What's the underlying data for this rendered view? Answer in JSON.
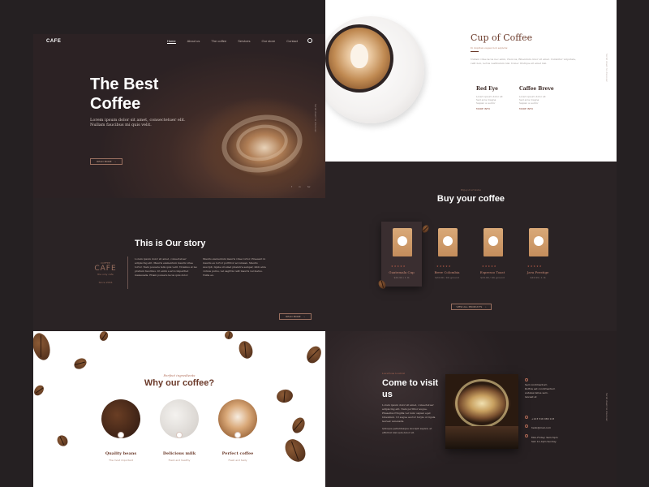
{
  "hero": {
    "logo": "CAFE",
    "nav": [
      "Home",
      "About us",
      "The coffee",
      "Services",
      "Our store",
      "Contact"
    ],
    "title": "The Best Coffee",
    "text": "Lorem ipsum dolor sit amet, consectetuer elit. Nullam faucibus mi quis velit.",
    "button": "READ MORE",
    "social": [
      "f",
      "in",
      "tw"
    ],
    "side_text": "Scroll down to discover"
  },
  "cup": {
    "title": "Cup of Coffee",
    "subtitle": "In dapibus augue non sapiens",
    "description": "Nullam vitae lacus nec enim, rhoncus, Bibendum dolor sit amet. Curabitur vulputate, velit non, lectus vestibulum nisi. Donec tristique sit amet nisi.",
    "items": [
      {
        "name": "Red Eye",
        "bullets": [
          "Lorem ipsum dolor sit",
          "Sed eros magna",
          "Sapien a auctor"
        ],
        "more": "MORE INFO"
      },
      {
        "name": "Caffee Breve",
        "bullets": [
          "Lorem ipsum dolor sit",
          "Sed eros magna",
          "Sapien a auctor"
        ],
        "more": "MORE INFO"
      }
    ],
    "side_text": "Scroll down to discover"
  },
  "story": {
    "title": "This is Our story",
    "badge_top": "COFFEE",
    "badge_main": "CAFE",
    "badge_sub": "the only cafe",
    "badge_since": "Since 2016",
    "col1": "Lorem ipsum dolor sit amet, consectetuer adipiscing elit. Mauris elementum mauris vitae tortor. Nam posuere felis quis velit. Vivamus et leo pretium faucibus. Ut enim a arcu imperdiet malesuada. Etiam posuere lacus quis dolor.",
    "col2": "Mauris elementum mauris vitae tortor. Praesent in mauris eu tortor porttitor accumsan. Mauris suscipit, ligula sit amet pharetra semper, nibh ante cursus purus, vel sagittis velit mauris vel metus. Nulla eu.",
    "button": "READ MORE"
  },
  "buy": {
    "sup": "Enjoy it at home",
    "title": "Buy your coffee",
    "stars": "★★★★★",
    "products": [
      {
        "name": "Guatemala Cup",
        "price": "$24.99 / 1 lb"
      },
      {
        "name": "Brew Colombia",
        "price": "$24.99 / 1lb ground"
      },
      {
        "name": "Espresso Toast",
        "price": "$24.99 / 1lb ground"
      },
      {
        "name": "Java Prestige",
        "price": "$24.99 / 1 lb"
      }
    ],
    "button": "VIEW ALL PRODUCTS"
  },
  "why": {
    "sup": "Perfect ingredients",
    "title": "Why our coffee?",
    "features": [
      {
        "name": "Quality beans",
        "sub": "The most important"
      },
      {
        "name": "Delicious milk",
        "sub": "Fresh and healthy"
      },
      {
        "name": "Perfect coffee",
        "sub": "Fresh and tasty"
      }
    ]
  },
  "visit": {
    "sup": "Luxurious location",
    "title": "Come to visit us",
    "desc1": "Lorem ipsum dolor sit amet, consectetuer adipiscing elit. Nam porttitor augue. Phasellus fringilla vel nunc sapien eget bibendum. Ut augue auctor turpis ut ligula laoreet venenatis.",
    "desc2": "Quisque pellentesque suscipit sapien, et efficitur nisl sem dolor sit.",
    "address": [
      "Sed condimentum",
      "Rolfnis est condimentum",
      "sodales tellus sem.",
      "laoreet et"
    ],
    "phone": "+123 516 980 123",
    "email": "hello@mail.com",
    "hours": "Mon-Friday: 9am-5pm",
    "hours2": "Sat: 11-4pm Sunday",
    "side_text": "Scroll down to discover"
  }
}
